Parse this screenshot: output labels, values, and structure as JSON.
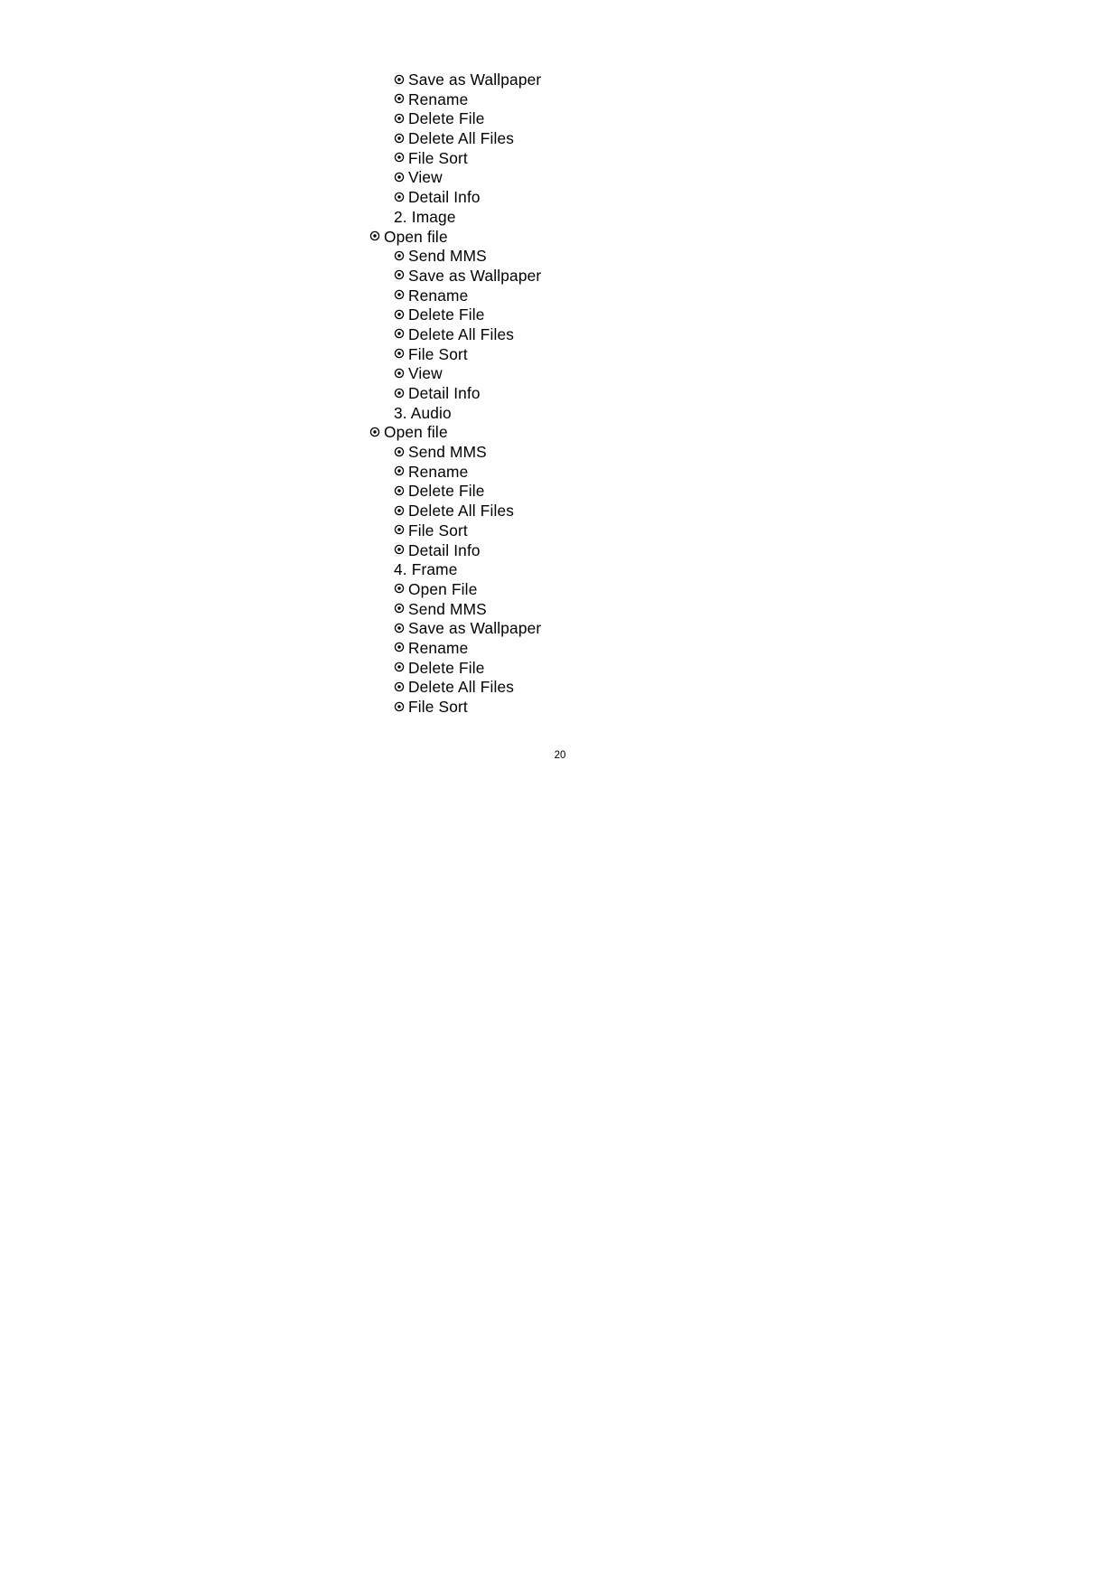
{
  "document": {
    "page_number": "20",
    "bullet_glyph": "circled-dot",
    "text_color": "#000000",
    "background_color": "#ffffff"
  },
  "outline": {
    "lines": [
      {
        "indent": 2,
        "bullet": true,
        "text": "Save as Wallpaper"
      },
      {
        "indent": 2,
        "bullet": true,
        "text": "Rename"
      },
      {
        "indent": 2,
        "bullet": true,
        "text": "Delete File"
      },
      {
        "indent": 2,
        "bullet": true,
        "text": "Delete All Files"
      },
      {
        "indent": 2,
        "bullet": true,
        "text": "File Sort"
      },
      {
        "indent": 2,
        "bullet": true,
        "text": "View"
      },
      {
        "indent": 2,
        "bullet": true,
        "text": "Detail Info"
      },
      {
        "indent": 2,
        "bullet": false,
        "text": "2. Image"
      },
      {
        "indent": 1,
        "bullet": true,
        "text": "Open file"
      },
      {
        "indent": 2,
        "bullet": true,
        "text": "Send MMS"
      },
      {
        "indent": 2,
        "bullet": true,
        "text": "Save as Wallpaper"
      },
      {
        "indent": 2,
        "bullet": true,
        "text": "Rename"
      },
      {
        "indent": 2,
        "bullet": true,
        "text": "Delete File"
      },
      {
        "indent": 2,
        "bullet": true,
        "text": "Delete All Files"
      },
      {
        "indent": 2,
        "bullet": true,
        "text": "File Sort"
      },
      {
        "indent": 2,
        "bullet": true,
        "text": "View"
      },
      {
        "indent": 2,
        "bullet": true,
        "text": "Detail Info"
      },
      {
        "indent": 2,
        "bullet": false,
        "text": "3. Audio"
      },
      {
        "indent": 1,
        "bullet": true,
        "text": "Open file"
      },
      {
        "indent": 2,
        "bullet": true,
        "text": "Send MMS"
      },
      {
        "indent": 2,
        "bullet": true,
        "text": "Rename"
      },
      {
        "indent": 2,
        "bullet": true,
        "text": "Delete File"
      },
      {
        "indent": 2,
        "bullet": true,
        "text": "Delete All Files"
      },
      {
        "indent": 2,
        "bullet": true,
        "text": "File Sort"
      },
      {
        "indent": 2,
        "bullet": true,
        "text": "Detail Info"
      },
      {
        "indent": 2,
        "bullet": false,
        "text": "4. Frame"
      },
      {
        "indent": 2,
        "bullet": true,
        "text": "Open File"
      },
      {
        "indent": 2,
        "bullet": true,
        "text": "Send MMS"
      },
      {
        "indent": 2,
        "bullet": true,
        "text": "Save as Wallpaper"
      },
      {
        "indent": 2,
        "bullet": true,
        "text": "Rename"
      },
      {
        "indent": 2,
        "bullet": true,
        "text": "Delete File"
      },
      {
        "indent": 2,
        "bullet": true,
        "text": "Delete All Files"
      },
      {
        "indent": 2,
        "bullet": true,
        "text": "File Sort"
      }
    ]
  }
}
